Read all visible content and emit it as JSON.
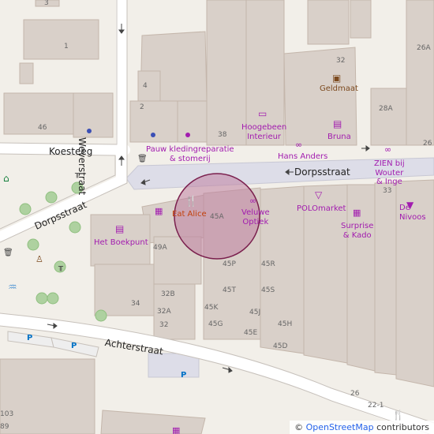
{
  "colors": {
    "background": "#f2efe9",
    "building": "#d9d0c9",
    "building_stroke": "#c4b6ab",
    "pedestrian_area": "#dddde8",
    "road": "#ffffff",
    "highlight_fill": "#c080a0",
    "highlight_stroke": "#7a1f4d",
    "poi_purple": "#a21caf",
    "poi_orange": "#c2410c",
    "tree": "#aed1a0",
    "water": "#5b9bd5",
    "parking": "#0072c6"
  },
  "streets": {
    "koesteeg": "Koesteeg",
    "weverstraat": "Weverstraat",
    "dorpsstraat_left": "Dorpsstraat",
    "dorpsstraat_right": "Dorpsstraat",
    "achterstraat": "Achterstraat"
  },
  "housenumbers": {
    "n3": "3",
    "n1": "1",
    "n4": "4",
    "n2": "2",
    "n46": "46",
    "n38": "38",
    "n32a": "32",
    "n26a": "26A",
    "n28a": "28A",
    "n26": "26",
    "n33": "33",
    "n45a": "45A",
    "n49a": "49A",
    "n45p": "45P",
    "n45r": "45R",
    "n32b": "32B",
    "n34": "34",
    "n32a2": "32A",
    "n32": "32",
    "n45t": "45T",
    "n45s": "45S",
    "n45k": "45K",
    "n45j": "45J",
    "n45g": "45G",
    "n45e": "45E",
    "n45h": "45H",
    "n45d": "45D",
    "n26b": "26",
    "n22": "22-1",
    "n103": "103",
    "n89": "89"
  },
  "pois": {
    "geldmaat": "Geldmaat",
    "hoogebeen": "Hoogebeen\nInterieur",
    "bruna": "Bruna",
    "pauw": "Pauw kledingreparatie\n& stomerij",
    "hans_anders": "Hans Anders",
    "zien": "ZIEN bij\nWouter\n& Inge",
    "eat_alice": "Eat Alice",
    "veluwe_optiek": "Veluwe\nOptiek",
    "polomarket": "POLOmarket",
    "de_nivoos": "De\nNivoos",
    "boekpunt": "Het Boekpunt",
    "surprise": "Surprise\n& Kado"
  },
  "parking_label": "P",
  "attribution": {
    "copyright": "©",
    "link": "OpenStreetMap",
    "suffix": "contributors"
  }
}
